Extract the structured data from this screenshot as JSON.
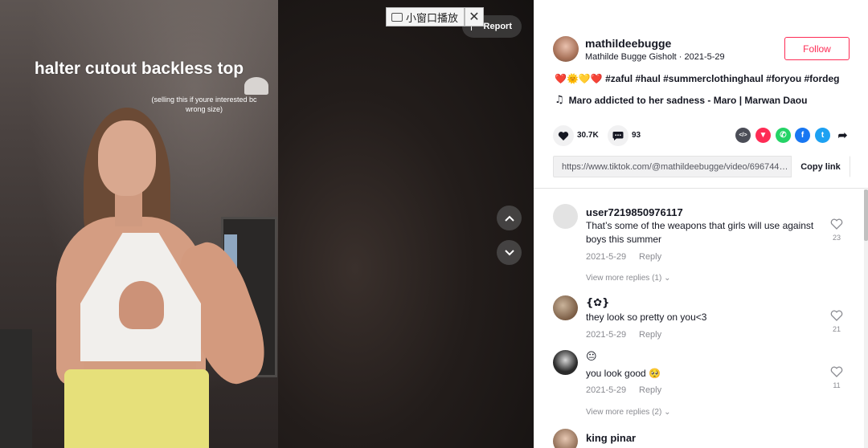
{
  "video": {
    "overlay_title": "halter cutout backless top",
    "overlay_subtitle": "(selling this if youre interested bc wrong size)",
    "mini_window_label": "小窗口播放",
    "close_symbol": "✕",
    "report_label": "Report"
  },
  "author": {
    "username": "mathildeebugge",
    "nickname_date": "Mathilde Bugge Gisholt · 2021-5-29",
    "follow_label": "Follow"
  },
  "post": {
    "caption_emojis": "❤️🌞💛❤️",
    "caption_tags": " #zaful #haul #summerclothinghaul #foryou #fordeg",
    "music": "Maro addicted to her sadness - Maro | Marwan Daou"
  },
  "stats": {
    "likes": "30.7K",
    "comments": "93"
  },
  "share_icons": [
    {
      "name": "embed-icon",
      "color": "#4b4d57",
      "glyph": "</>"
    },
    {
      "name": "tiktok-send-icon",
      "color": "#fe2c55",
      "glyph": "▼"
    },
    {
      "name": "whatsapp-icon",
      "color": "#25d366",
      "glyph": "✆"
    },
    {
      "name": "facebook-icon",
      "color": "#1877f2",
      "glyph": "f"
    },
    {
      "name": "twitter-icon",
      "color": "#1da1f2",
      "glyph": "t"
    },
    {
      "name": "share-more-icon",
      "color": "#ffffff",
      "glyph": "➦"
    }
  ],
  "link": {
    "url": "https://www.tiktok.com/@mathildeebugge/video/69674485...",
    "copy_label": "Copy link"
  },
  "comments": [
    {
      "name": "user7219850976117",
      "text": "That’s some of the weapons that girls will use against boys this summer",
      "date": "2021-5-29",
      "reply": "Reply",
      "likes": "23",
      "view_more": "View more replies (1)"
    },
    {
      "name": "{✿}",
      "text": "they look so pretty on you<3",
      "date": "2021-5-29",
      "reply": "Reply",
      "likes": "21"
    },
    {
      "name": "😐",
      "text": "you look good 🥺",
      "date": "2021-5-29",
      "reply": "Reply",
      "likes": "11",
      "view_more": "View more replies (2)"
    },
    {
      "name": "king pinar"
    }
  ],
  "colors": {
    "accent": "#fe2c55",
    "text": "#161823",
    "muted": "#8a8b91"
  }
}
